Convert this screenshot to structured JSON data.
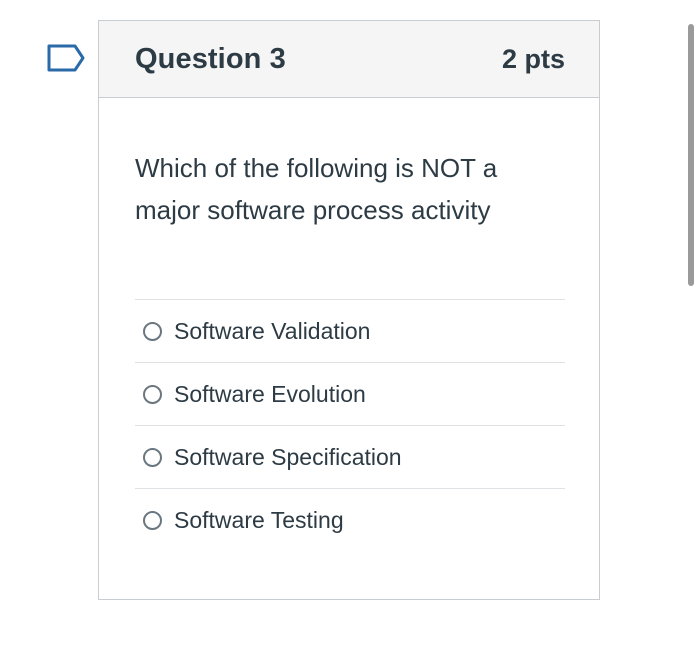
{
  "question": {
    "title": "Question 3",
    "points": "2 pts",
    "text": "Which of the following is NOT a major software process activity",
    "flag_icon": "flag-icon",
    "answers": [
      {
        "label": "Software Validation",
        "selected": false
      },
      {
        "label": "Software Evolution",
        "selected": false
      },
      {
        "label": "Software Specification",
        "selected": false
      },
      {
        "label": "Software Testing",
        "selected": false
      }
    ]
  },
  "colors": {
    "text": "#2d3b45",
    "header_bg": "#f5f5f5",
    "border": "#c7cdd1",
    "flag_outline": "#2b6aa8",
    "scrollbar": "#9a9a9a"
  }
}
